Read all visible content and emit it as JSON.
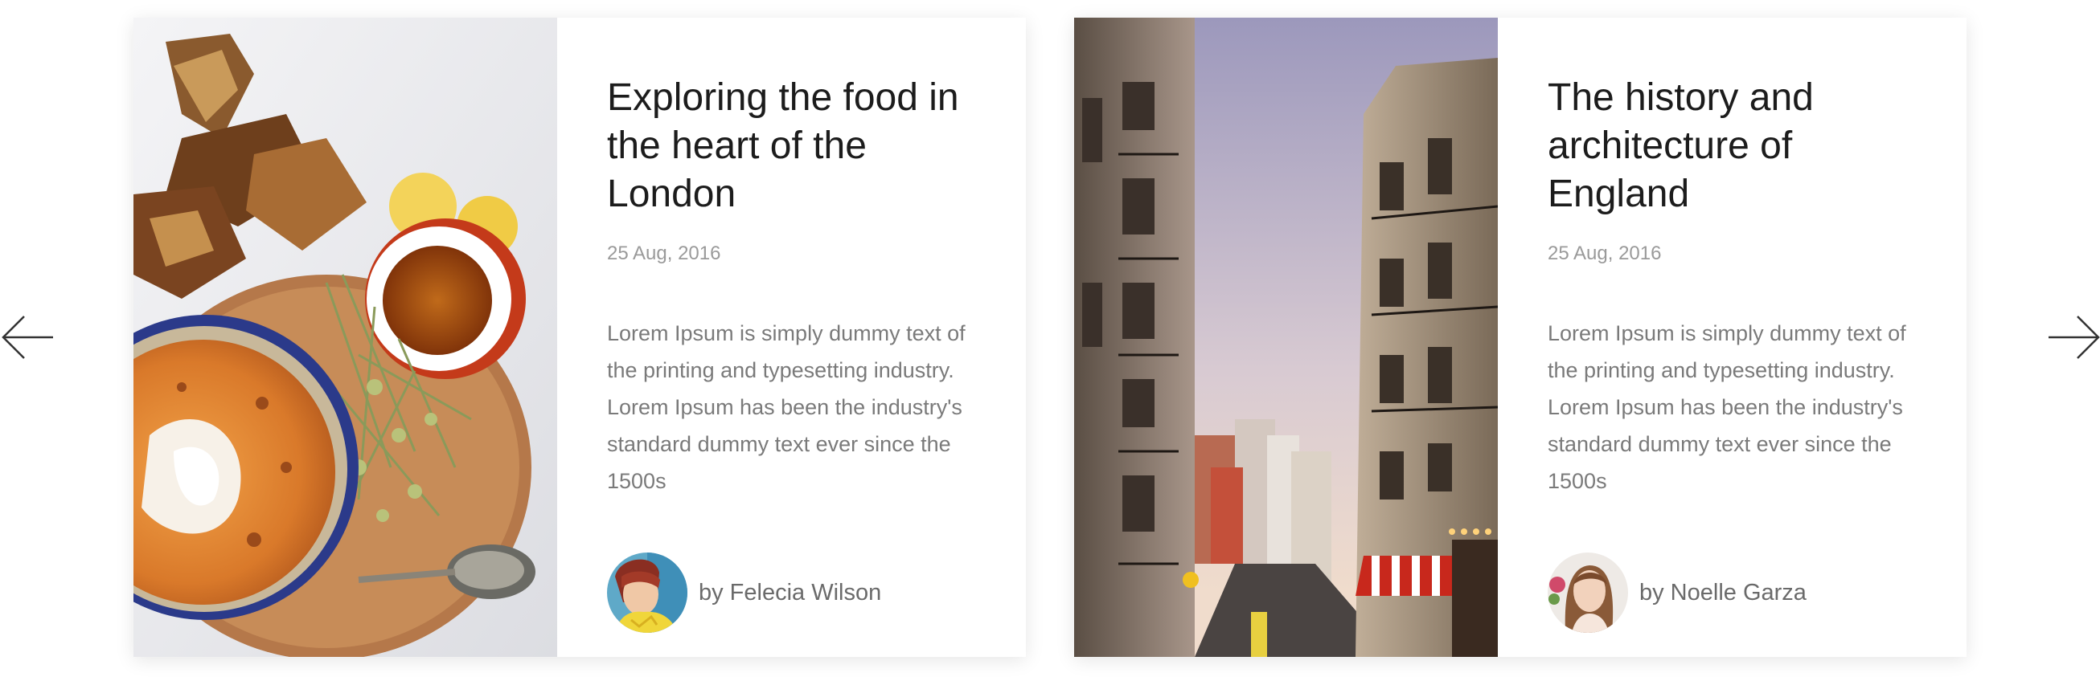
{
  "navigation": {
    "prev_icon": "arrow-left-icon",
    "next_icon": "arrow-right-icon"
  },
  "cards": [
    {
      "title": "Exploring the food in the heart of the London",
      "date": "25 Aug, 2016",
      "excerpt": "Lorem Ipsum is simply dummy text of the printing and typesetting industry. Lorem Ipsum has been the industry's standard dummy text ever since the 1500s",
      "author": "by Felecia Wilson",
      "image": "food-photo"
    },
    {
      "title": "The history and architecture of England",
      "date": "25 Aug, 2016",
      "excerpt": "Lorem Ipsum is simply dummy text of the printing and typesetting industry. Lorem Ipsum has been the industry's standard dummy text ever since the 1500s",
      "author": "by Noelle Garza",
      "image": "street-photo"
    }
  ],
  "colors": {
    "title": "#1c1c1c",
    "date": "#9a9a9a",
    "excerpt": "#7a7a7a",
    "author": "#6a6a6a"
  }
}
